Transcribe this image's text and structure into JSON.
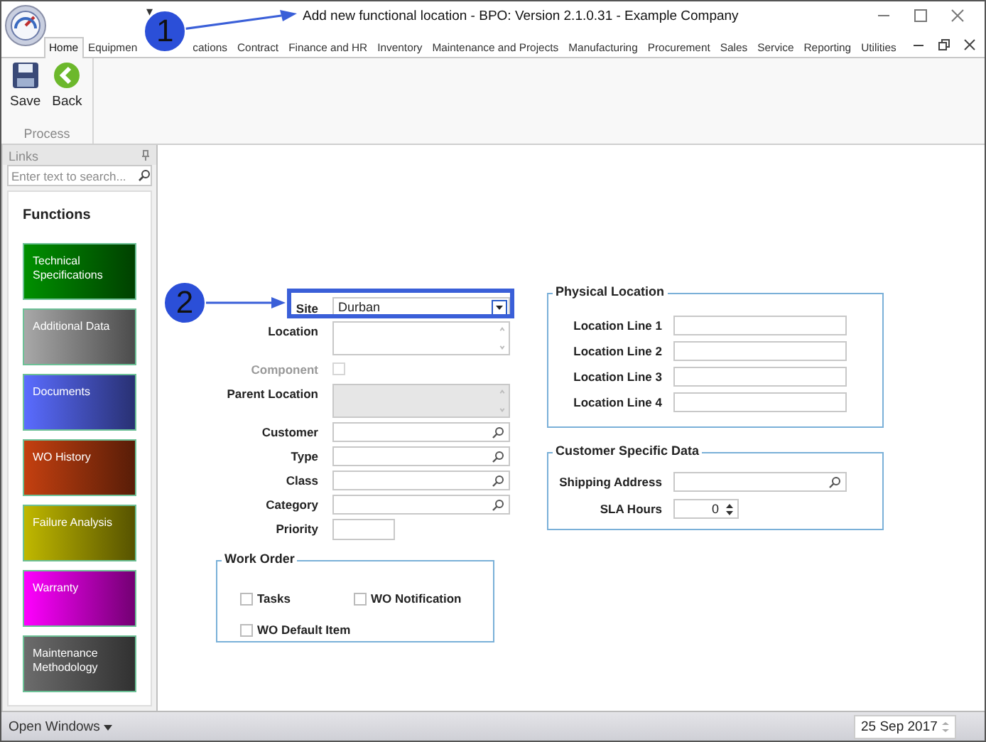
{
  "window": {
    "title": "Add new functional location - BPO: Version 2.1.0.31 - Example Company",
    "quick_access": "▾"
  },
  "tabs": [
    {
      "label": "Home",
      "selected": true
    },
    {
      "label": "Equipmen",
      "selected": false
    },
    {
      "label": "cations",
      "selected": false
    },
    {
      "label": "Contract",
      "selected": false
    },
    {
      "label": "Finance and HR",
      "selected": false
    },
    {
      "label": "Inventory",
      "selected": false
    },
    {
      "label": "Maintenance and Projects",
      "selected": false
    },
    {
      "label": "Manufacturing",
      "selected": false
    },
    {
      "label": "Procurement",
      "selected": false
    },
    {
      "label": "Sales",
      "selected": false
    },
    {
      "label": "Service",
      "selected": false
    },
    {
      "label": "Reporting",
      "selected": false
    },
    {
      "label": "Utilities",
      "selected": false
    }
  ],
  "ribbon": {
    "buttons": [
      {
        "label": "Save",
        "kind": "save"
      },
      {
        "label": "Back",
        "kind": "back"
      }
    ],
    "group": "Process"
  },
  "links": {
    "title": "Links",
    "search": {
      "placeholder": "Enter text to search..."
    },
    "heading": "Functions",
    "items": [
      {
        "label": "Technical Specifications",
        "color": "#009000"
      },
      {
        "label": "Additional Data",
        "color": "#a8a8a8"
      },
      {
        "label": "Documents",
        "color": "#5a6cff"
      },
      {
        "label": "WO History",
        "color": "#c44010"
      },
      {
        "label": "Failure Analysis",
        "color": "#c0b800"
      },
      {
        "label": "Warranty",
        "color": "#ff00ff"
      },
      {
        "label": "Maintenance Methodology",
        "color": "#6c6c6c"
      }
    ]
  },
  "form": {
    "site": {
      "label": "Site",
      "value": "Durban"
    },
    "fields": [
      {
        "label": "Location",
        "kind": "textarea",
        "disabled": false
      },
      {
        "label": "Component",
        "kind": "checkbox",
        "disabled": true,
        "checked": false
      },
      {
        "label": "Parent Location",
        "kind": "textarea",
        "disabled": true
      },
      {
        "label": "Customer",
        "kind": "lookup",
        "disabled": false
      },
      {
        "label": "Type",
        "kind": "lookup",
        "disabled": false
      },
      {
        "label": "Class",
        "kind": "lookup",
        "disabled": false
      },
      {
        "label": "Category",
        "kind": "lookup",
        "disabled": false
      },
      {
        "label": "Priority",
        "kind": "short",
        "disabled": false
      }
    ],
    "work_order": {
      "title": "Work Order",
      "options": [
        {
          "label": "Tasks",
          "checked": false
        },
        {
          "label": "WO Notification",
          "checked": false
        },
        {
          "label": "WO Default Item",
          "checked": false
        }
      ]
    },
    "physical_location": {
      "title": "Physical Location",
      "fields": [
        {
          "label": "Location Line 1"
        },
        {
          "label": "Location Line 2"
        },
        {
          "label": "Location Line 3"
        },
        {
          "label": "Location Line 4"
        }
      ]
    },
    "customer_data": {
      "title": "Customer Specific Data",
      "shipping_address": {
        "label": "Shipping Address"
      },
      "sla_hours": {
        "label": "SLA Hours",
        "value": "0"
      }
    }
  },
  "status_bar": {
    "open_windows": "Open Windows",
    "date": "25 Sep 2017"
  },
  "callouts": [
    "1",
    "2"
  ]
}
